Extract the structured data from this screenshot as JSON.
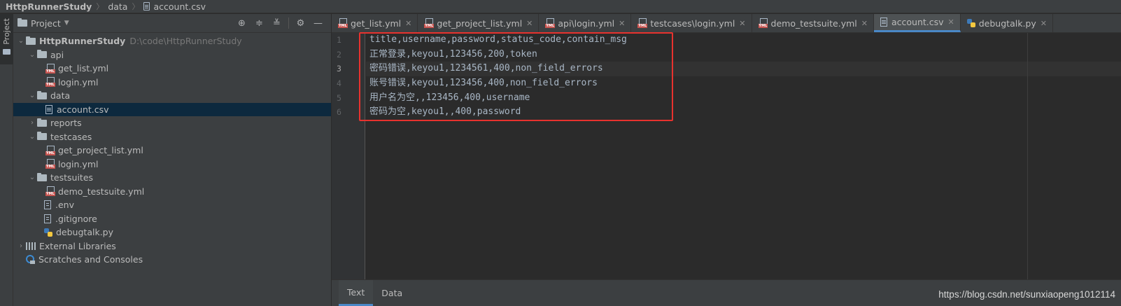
{
  "breadcrumb": {
    "project": "HttpRunnerStudy",
    "folder": "data",
    "file": "account.csv"
  },
  "tool_strip": {
    "project_label": "Project"
  },
  "project_panel": {
    "title": "Project",
    "tree": [
      {
        "label": "HttpRunnerStudy",
        "path": "D:\\code\\HttpRunnerStudy"
      },
      {
        "label": "api"
      },
      {
        "label": "get_list.yml"
      },
      {
        "label": "login.yml"
      },
      {
        "label": "data"
      },
      {
        "label": "account.csv"
      },
      {
        "label": "reports"
      },
      {
        "label": "testcases"
      },
      {
        "label": "get_project_list.yml"
      },
      {
        "label": "login.yml"
      },
      {
        "label": "testsuites"
      },
      {
        "label": "demo_testsuite.yml"
      },
      {
        "label": ".env"
      },
      {
        "label": ".gitignore"
      },
      {
        "label": "debugtalk.py"
      },
      {
        "label": "External Libraries"
      },
      {
        "label": "Scratches and Consoles"
      }
    ]
  },
  "tabs": [
    {
      "label": "get_list.yml"
    },
    {
      "label": "get_project_list.yml"
    },
    {
      "label": "api\\login.yml"
    },
    {
      "label": "testcases\\login.yml"
    },
    {
      "label": "demo_testsuite.yml"
    },
    {
      "label": "account.csv"
    },
    {
      "label": "debugtalk.py"
    }
  ],
  "editor": {
    "line_numbers": [
      "1",
      "2",
      "3",
      "4",
      "5",
      "6"
    ],
    "lines": [
      "title,username,password,status_code,contain_msg",
      "正常登录,keyou1,123456,200,token",
      "密码错误,keyou1,1234561,400,non_field_errors",
      "账号错误,keyou1,123456,400,non_field_errors",
      "用户名为空,,123456,400,username",
      "密码为空,keyou1,,400,password"
    ]
  },
  "bottom_tabs": {
    "text": "Text",
    "data": "Data"
  },
  "watermark": "https://blog.csdn.net/sunxiaopeng1012114",
  "colors": {
    "accent": "#4a88c7",
    "highlight_box": "#e8322e",
    "selection": "#0d293e"
  }
}
